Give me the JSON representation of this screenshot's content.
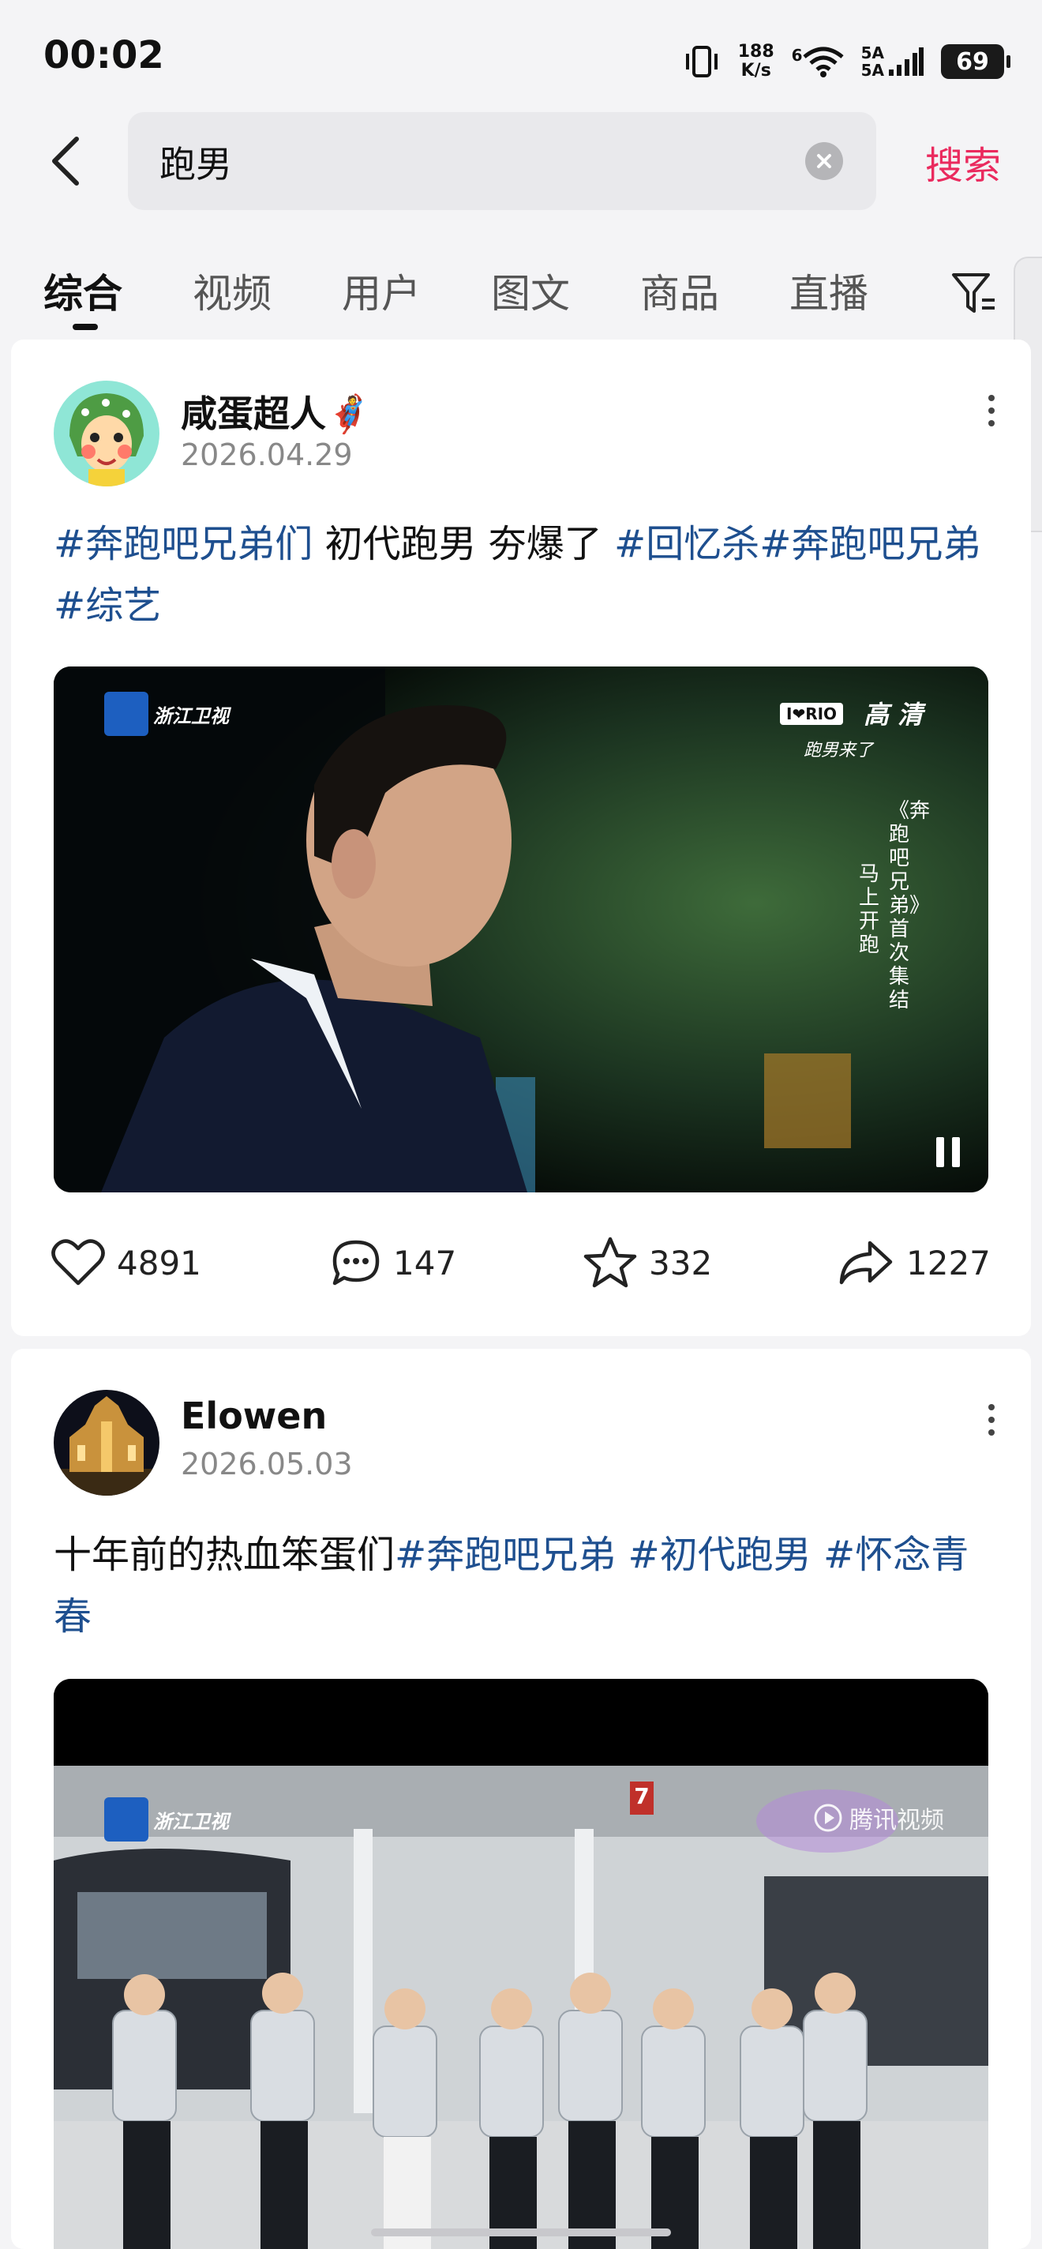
{
  "status_bar": {
    "time": "00:02",
    "speed_value": "188",
    "speed_unit": "K/s",
    "wifi_label": "6",
    "signal_label_1": "5A",
    "signal_label_2": "5A",
    "battery": "69"
  },
  "search": {
    "query": "跑男",
    "submit_label": "搜索"
  },
  "tabs": [
    {
      "label": "综合",
      "active": true
    },
    {
      "label": "视频"
    },
    {
      "label": "用户"
    },
    {
      "label": "图文"
    },
    {
      "label": "商品"
    },
    {
      "label": "直播"
    }
  ],
  "posts": [
    {
      "username": "咸蛋超人🦸",
      "date": "2026.04.29",
      "text_segments": [
        {
          "text": "#奔跑吧兄弟们 ",
          "tag": true
        },
        {
          "text": " 初代跑男 夯爆了 ",
          "tag": false
        },
        {
          "text": "#回忆杀",
          "tag": true
        },
        {
          "text": "#奔跑吧兄弟 ",
          "tag": true
        },
        {
          "text": "#综艺",
          "tag": true
        }
      ],
      "video": {
        "channel_logo": "浙江卫视",
        "badge_top": "I❤RIO",
        "badge_sub": "跑男来了",
        "quality": "高 清",
        "caption_main": "《奔跑吧兄弟》首次集结",
        "caption_sub": "马上开跑"
      },
      "stats": {
        "likes": "4891",
        "comments": "147",
        "favorites": "332",
        "shares": "1227"
      }
    },
    {
      "username": "Elowen",
      "date": "2026.05.03",
      "text_segments": [
        {
          "text": "十年前的热血笨蛋们",
          "tag": false
        },
        {
          "text": "#奔跑吧兄弟 ",
          "tag": true
        },
        {
          "text": "#初代跑男 ",
          "tag": true
        },
        {
          "text": "#怀念青春",
          "tag": true
        }
      ],
      "video": {
        "channel_logo": "浙江卫视",
        "watermark": "腾讯视频",
        "platform_number": "7"
      }
    }
  ],
  "colors": {
    "accent": "#ea2a5e",
    "hashtag": "#1e4f8f",
    "background": "#f4f4f6"
  }
}
